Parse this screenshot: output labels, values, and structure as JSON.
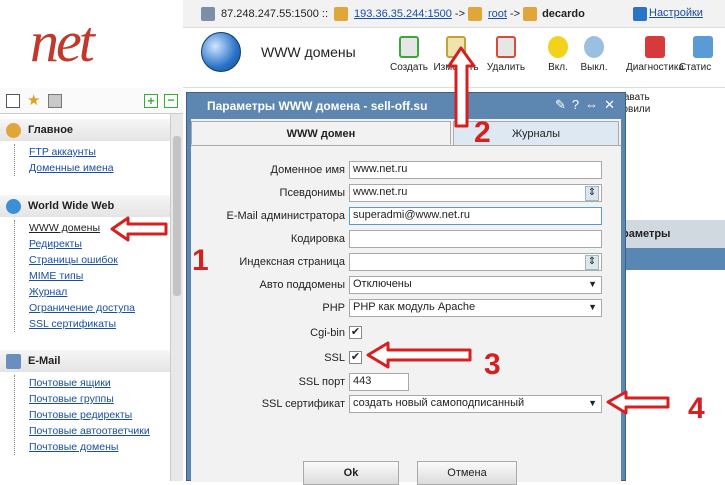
{
  "logo": {
    "text": "net",
    "prefix": "n"
  },
  "infobar": {
    "ip": "87.248.247.55:1500 ::",
    "remote_ip": "193.36.35.244:1500",
    "arrow1": "->",
    "user1": "root",
    "arrow2": "->",
    "user2": "decardo",
    "settings": "Настройки"
  },
  "toolbar": {
    "title": "WWW домены",
    "buttons": [
      {
        "label": "Создать",
        "color": "#3aa83a"
      },
      {
        "label": "Изменить",
        "color": "#c2a23a"
      },
      {
        "label": "Удалить",
        "color": "#d84a3a"
      },
      {
        "label": "Вкл.",
        "color": "#f2d21a"
      },
      {
        "label": "Выкл.",
        "color": "#9bbfe0"
      },
      {
        "label": "Диагностика",
        "color": "#d63a3a"
      },
      {
        "label": "Статис",
        "color": "#5b9bd5"
      }
    ]
  },
  "sidebar": {
    "groups": [
      {
        "title": "Главное",
        "icon": "home-icon",
        "items": [
          "FTP аккаунты",
          "Доменные имена"
        ]
      },
      {
        "title": "World Wide Web",
        "icon": "globe-icon",
        "items": [
          "WWW домены",
          "Редиректы",
          "Страницы ошибок",
          "MIME типы",
          "Журнал",
          "Ограничение доступа",
          "SSL сертификаты"
        ]
      },
      {
        "title": "E-Mail",
        "icon": "mail-icon",
        "items": [
          "Почтовые ящики",
          "Почтовые группы",
          "Почтовые редиректы",
          "Почтовые автоответчики",
          "Почтовые домены"
        ]
      }
    ]
  },
  "behind": {
    "line1": "давать",
    "line2": "товили",
    "header": "раметры"
  },
  "dialog": {
    "title": "Параметры WWW домена - sell-off.su",
    "tabs": [
      "WWW домен",
      "Журналы"
    ],
    "fields": {
      "domain_label": "Доменное имя",
      "domain_value": "www.net.ru",
      "alias_label": "Псевдонимы",
      "alias_value": "www.net.ru",
      "email_label": "E-Mail администратора",
      "email_value": "superadmi@www.net.ru",
      "charset_label": "Кодировка",
      "charset_value": "",
      "index_label": "Индексная страница",
      "index_value": "",
      "autosub_label": "Авто поддомены",
      "autosub_value": "Отключены",
      "php_label": "PHP",
      "php_value": "PHP как модуль Apache",
      "cgi_label": "Cgi-bin",
      "cgi_checked": "✔",
      "ssl_label": "SSL",
      "ssl_checked": "✔",
      "sslport_label": "SSL порт",
      "sslport_value": "443",
      "sslcert_label": "SSL сертификат",
      "sslcert_value": "создать новый самоподписанный"
    },
    "ok": "Ok",
    "cancel": "Отмена"
  },
  "annotations": [
    "1",
    "2",
    "3",
    "4"
  ],
  "colors": {
    "accent": "#d62020",
    "dialog_title": "#5d86b0",
    "link": "#1a4ea0"
  }
}
